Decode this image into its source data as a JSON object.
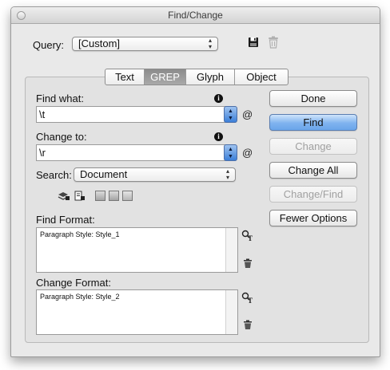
{
  "window": {
    "title": "Find/Change"
  },
  "query": {
    "label": "Query:",
    "value": "[Custom]",
    "save_icon": "floppy-disk-icon",
    "delete_icon": "trash-icon"
  },
  "tabs": [
    {
      "label": "Text",
      "selected": false
    },
    {
      "label": "GREP",
      "selected": true
    },
    {
      "label": "Glyph",
      "selected": false
    },
    {
      "label": "Object",
      "selected": false
    }
  ],
  "find": {
    "label": "Find what:",
    "value": "\\t",
    "special_chars_button": "@"
  },
  "change": {
    "label": "Change to:",
    "value": "\\r",
    "special_chars_button": "@"
  },
  "search": {
    "label": "Search:",
    "value": "Document"
  },
  "options_icons": [
    "locked-layers-icon",
    "locked-stories-icon",
    "hidden-layers-icon",
    "master-pages-icon",
    "footnotes-icon"
  ],
  "find_format": {
    "label": "Find Format:",
    "value": "Paragraph Style: Style_1"
  },
  "change_format": {
    "label": "Change Format:",
    "value": "Paragraph Style: Style_2"
  },
  "buttons": {
    "done": "Done",
    "find": "Find",
    "change": "Change",
    "change_all": "Change All",
    "change_find": "Change/Find",
    "fewer_options": "Fewer Options"
  },
  "colors": {
    "default_button": "#7fb3ef",
    "selected_tab": "#9a9a9a",
    "window_bg": "#e9e9e9"
  }
}
